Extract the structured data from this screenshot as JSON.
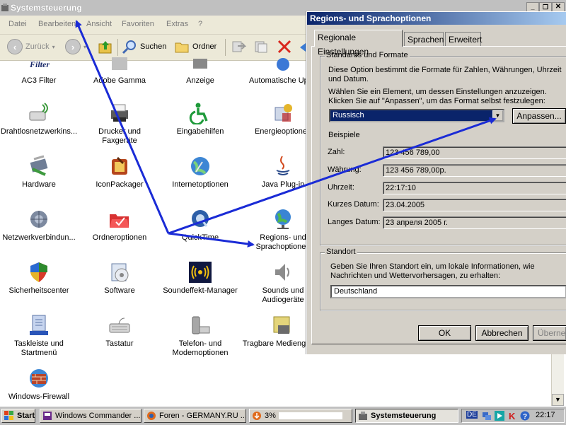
{
  "control_panel": {
    "title": "Systemsteuerung",
    "menu": [
      "Datei",
      "Bearbeiten",
      "Ansicht",
      "Favoriten",
      "Extras",
      "?"
    ],
    "toolbar": {
      "back": "Zurück",
      "search": "Suchen",
      "folders": "Ordner"
    },
    "items": [
      {
        "label": "AC3 Filter",
        "icon": "ac3-filter-icon"
      },
      {
        "label": "Adobe Gamma",
        "icon": "adobe-gamma-icon"
      },
      {
        "label": "Anzeige",
        "icon": "display-icon"
      },
      {
        "label": "Automatische Upda",
        "icon": "automatic-updates-icon"
      },
      {
        "label": "Drahtlosnetzwerkins...",
        "icon": "wireless-network-icon"
      },
      {
        "label": "Drucker und Faxgeräte",
        "icon": "printer-icon"
      },
      {
        "label": "Eingabehilfen",
        "icon": "accessibility-icon"
      },
      {
        "label": "Energieoptionen",
        "icon": "power-options-icon"
      },
      {
        "label": "Hardware",
        "icon": "hardware-icon"
      },
      {
        "label": "IconPackager",
        "icon": "iconpackager-icon"
      },
      {
        "label": "Internetoptionen",
        "icon": "internet-options-icon"
      },
      {
        "label": "Java Plug-in",
        "icon": "java-icon"
      },
      {
        "label": "Netzwerkverbindun...",
        "icon": "network-connections-icon"
      },
      {
        "label": "Ordneroptionen",
        "icon": "folder-options-icon"
      },
      {
        "label": "QuickTime",
        "icon": "quicktime-icon"
      },
      {
        "label": "Regions- und Sprachoptionen",
        "icon": "regional-options-icon"
      },
      {
        "label": "Sicherheitscenter",
        "icon": "security-center-icon"
      },
      {
        "label": "Software",
        "icon": "software-icon"
      },
      {
        "label": "Soundeffekt-Manager",
        "icon": "sound-effect-manager-icon"
      },
      {
        "label": "Sounds und Audiogeräte",
        "icon": "sounds-icon"
      },
      {
        "label": "Taskleiste und Startmenü",
        "icon": "taskbar-icon"
      },
      {
        "label": "Tastatur",
        "icon": "keyboard-icon"
      },
      {
        "label": "Telefon- und Modemoptionen",
        "icon": "phone-modem-icon"
      },
      {
        "label": "Tragbare Mediengeräte",
        "icon": "portable-media-icon"
      },
      {
        "label": "Windows-Firewall",
        "icon": "firewall-icon"
      }
    ]
  },
  "dialog": {
    "title": "Regions- und Sprachoptionen",
    "tabs": [
      "Regionale Einstellungen",
      "Sprachen",
      "Erweitert"
    ],
    "standards_group": {
      "legend": "Standards und Formate",
      "description1": "Diese Option bestimmt die Formate für Zahlen, Währungen, Uhrzeit und Datum.",
      "description2": "Wählen Sie ein Element, um dessen Einstellungen anzuzeigen. Klicken Sie auf \"Anpassen\", um das Format selbst festzulegen:",
      "selected_locale": "Russisch",
      "customize_button": "Anpassen...",
      "examples_label": "Beispiele",
      "examples": [
        {
          "label": "Zahl:",
          "value": "123 456 789,00"
        },
        {
          "label": "Währung:",
          "value": "123 456 789,00р."
        },
        {
          "label": "Uhrzeit:",
          "value": "22:17:10"
        },
        {
          "label": "Kurzes Datum:",
          "value": "23.04.2005"
        },
        {
          "label": "Langes Datum:",
          "value": "23 апреля 2005 г."
        }
      ]
    },
    "location_group": {
      "legend": "Standort",
      "description": "Geben Sie Ihren Standort ein, um lokale Informationen, wie Nachrichten und Wettervorhersagen, zu erhalten:",
      "selected_location": "Deutschland"
    },
    "buttons": {
      "ok": "OK",
      "cancel": "Abbrechen",
      "apply": "Übernehmen"
    }
  },
  "taskbar": {
    "start": "Start",
    "tasks": [
      {
        "label": "Windows Commander ...",
        "active": false
      },
      {
        "label": "Foren - GERMANY.RU ...",
        "active": false
      },
      {
        "label": "3%",
        "active": false
      },
      {
        "label": "Systemsteuerung",
        "active": true
      }
    ],
    "language": "DE",
    "clock": "22:17"
  },
  "colors": {
    "arrow": "#1a2bd6",
    "dialog_title": "#0a246a",
    "selection": "#0a246a"
  }
}
